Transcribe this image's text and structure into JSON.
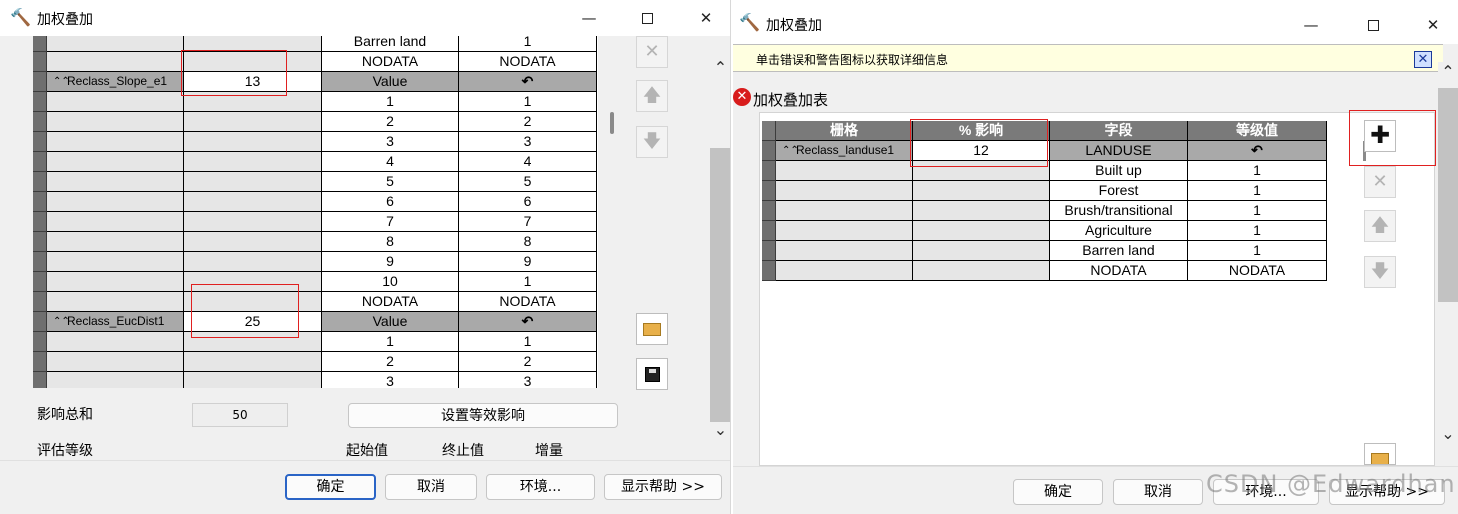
{
  "left": {
    "title": "加权叠加",
    "icons": {
      "app": "hammer-icon",
      "remove": "x-icon",
      "up": "arrow-up-icon",
      "down": "arrow-down-icon",
      "open": "folder-open-icon",
      "save": "save-icon"
    },
    "table_top_rows": [
      {
        "field": "Barren land",
        "scale": "1"
      },
      {
        "field": "NODATA",
        "scale": "NODATA"
      }
    ],
    "group1": {
      "raster": "Reclass_Slope_e1",
      "influence": "13",
      "field_header": "Value",
      "scale_header": "↶",
      "rows": [
        {
          "field": "1",
          "scale": "1"
        },
        {
          "field": "2",
          "scale": "2"
        },
        {
          "field": "3",
          "scale": "3"
        },
        {
          "field": "4",
          "scale": "4"
        },
        {
          "field": "5",
          "scale": "5"
        },
        {
          "field": "6",
          "scale": "6"
        },
        {
          "field": "7",
          "scale": "7"
        },
        {
          "field": "8",
          "scale": "8"
        },
        {
          "field": "9",
          "scale": "9"
        },
        {
          "field": "10",
          "scale": "1"
        },
        {
          "field": "NODATA",
          "scale": "NODATA"
        }
      ]
    },
    "group2": {
      "raster": "Reclass_EucDist1",
      "influence": "25",
      "field_header": "Value",
      "scale_header": "↶",
      "rows": [
        {
          "field": "1",
          "scale": "1"
        },
        {
          "field": "2",
          "scale": "2"
        },
        {
          "field": "3",
          "scale": "3"
        }
      ]
    },
    "sum_label": "影响总和",
    "sum_value": "50",
    "equal_button": "设置等效影响",
    "eval_label": "评估等级",
    "eval_headers": [
      "起始值",
      "终止值",
      "增量"
    ],
    "buttons": {
      "ok": "确定",
      "cancel": "取消",
      "env": "环境...",
      "help": "显示帮助 >>"
    }
  },
  "right": {
    "title": "加权叠加",
    "banner": "单击错误和警告图标以获取详细信息",
    "banner_close_icon": "close-x-icon",
    "error_icon": "error-icon",
    "section_label": "加权叠加表",
    "columns": [
      "栅格",
      "% 影响",
      "字段",
      "等级值"
    ],
    "group": {
      "raster": "Reclass_landuse1",
      "influence": "12",
      "field_header": "LANDUSE",
      "scale_header": "↶",
      "rows": [
        {
          "field": "Built up",
          "scale": "1"
        },
        {
          "field": "Forest",
          "scale": "1"
        },
        {
          "field": "Brush/transitional",
          "scale": "1"
        },
        {
          "field": "Agriculture",
          "scale": "1"
        },
        {
          "field": "Barren land",
          "scale": "1"
        },
        {
          "field": "NODATA",
          "scale": "NODATA"
        }
      ]
    },
    "icons": {
      "add": "plus-icon",
      "remove": "x-icon",
      "up": "arrow-up-icon",
      "down": "arrow-down-icon",
      "open": "folder-open-icon"
    },
    "buttons": {
      "ok": "确定",
      "cancel": "取消",
      "env": "环境...",
      "help": "显示帮助 >>"
    },
    "watermark": "CSDN @Edwardhan"
  },
  "colors": {
    "highlight_box": "#e02020",
    "banner_bg": "#ffffe0",
    "header_gray": "#7a7a7a",
    "group_gray": "#a9a9a9"
  }
}
